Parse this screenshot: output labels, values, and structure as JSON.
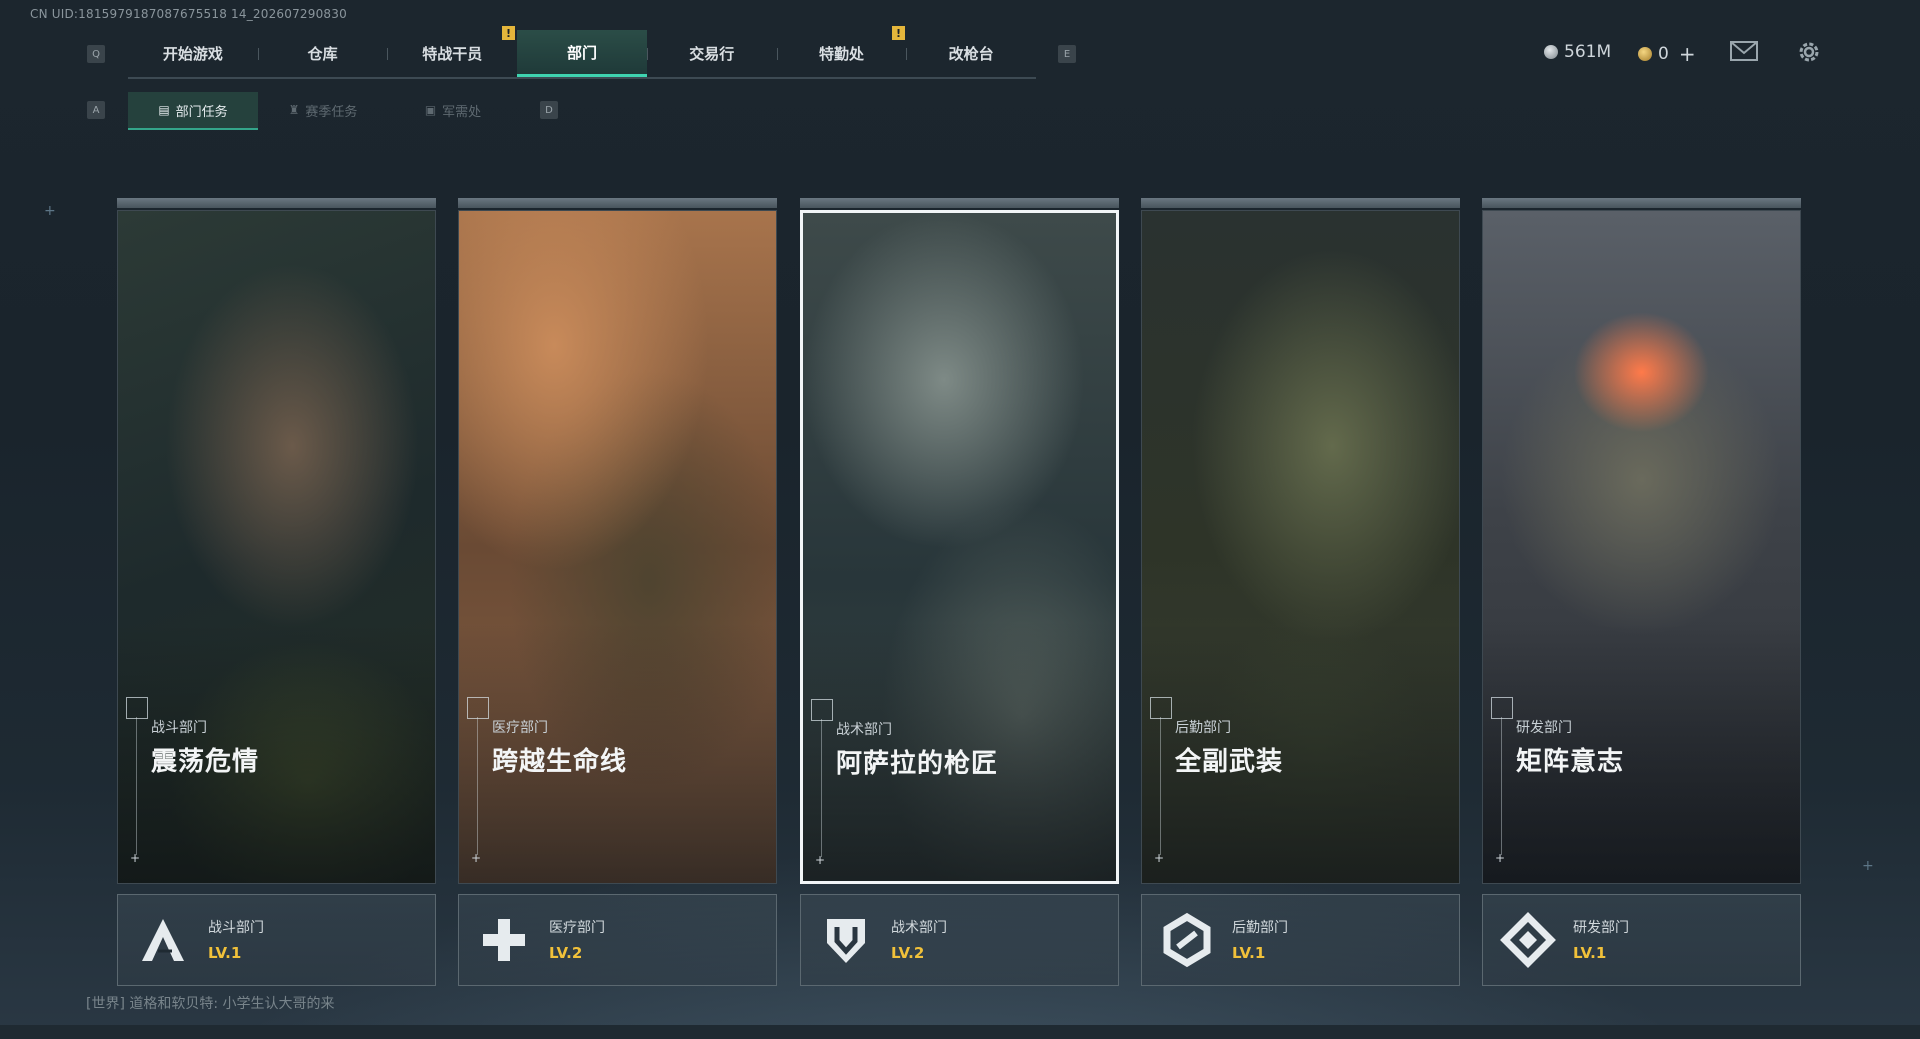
{
  "uid": "CN UID:1815979187087675518 14_202607290830",
  "top_nav": {
    "left_key": "Q",
    "right_key": "E",
    "tabs": [
      {
        "label": "开始游戏"
      },
      {
        "label": "仓库"
      },
      {
        "label": "特战干员"
      },
      {
        "label": "部门",
        "active": true
      },
      {
        "label": "交易行"
      },
      {
        "label": "特勤处"
      },
      {
        "label": "改枪台"
      }
    ],
    "warning_glyph": "!"
  },
  "resources": {
    "currency_a": "561M",
    "currency_b": "0",
    "add_glyph": "+"
  },
  "sub_nav": {
    "left_key": "A",
    "right_key": "D",
    "tabs": [
      {
        "label": "部门任务",
        "active": true
      },
      {
        "label": "赛季任务"
      },
      {
        "label": "军需处"
      }
    ]
  },
  "departments": [
    {
      "dept": "战斗部门",
      "title": "震荡危情",
      "level_name": "战斗部门",
      "level": "LV.1",
      "icon": "assault-a-icon"
    },
    {
      "dept": "医疗部门",
      "title": "跨越生命线",
      "level_name": "医疗部门",
      "level": "LV.2",
      "icon": "medical-cross-icon"
    },
    {
      "dept": "战术部门",
      "title": "阿萨拉的枪匠",
      "level_name": "战术部门",
      "level": "LV.2",
      "icon": "tactical-shield-icon",
      "selected": true
    },
    {
      "dept": "后勤部门",
      "title": "全副武装",
      "level_name": "后勤部门",
      "level": "LV.1",
      "icon": "logistics-hex-icon"
    },
    {
      "dept": "研发部门",
      "title": "矩阵意志",
      "level_name": "研发部门",
      "level": "LV.1",
      "icon": "research-diamond-icon"
    }
  ],
  "chat": "[世界] 道格和软贝特: 小学生认大哥的来",
  "colors": {
    "accent": "#3fd3b0",
    "level": "#f1c13a",
    "warning": "#e5b63b"
  }
}
